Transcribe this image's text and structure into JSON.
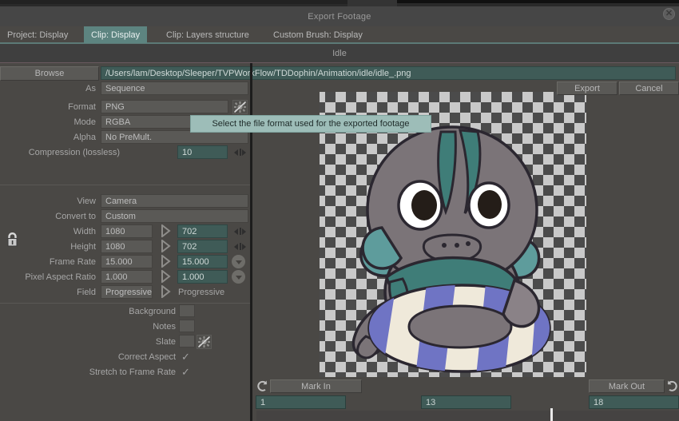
{
  "window": {
    "title": "Export Footage",
    "close_icon": "close-icon"
  },
  "tabs": [
    {
      "label": "Project: Display",
      "active": false
    },
    {
      "label": "Clip: Display",
      "active": true
    },
    {
      "label": "Clip: Layers structure",
      "active": false
    },
    {
      "label": "Custom Brush: Display",
      "active": false
    }
  ],
  "subtitle": "Idle",
  "browse": {
    "button_label": "Browse",
    "path_value": "/Users/lam/Desktop/Sleeper/TVPWorkFlow/TDDophin/Animation/idle/idle_.png"
  },
  "actions": {
    "export_label": "Export",
    "cancel_label": "Cancel"
  },
  "tooltip": {
    "text": "Select the file format used for the exported footage",
    "background": "#9dbdb8",
    "color": "#1e2a28"
  },
  "form": {
    "as": {
      "label": "As",
      "value": "Sequence"
    },
    "format": {
      "label": "Format",
      "value": "PNG",
      "gear_icon": "gear-disabled-icon"
    },
    "mode": {
      "label": "Mode",
      "value": "RGBA"
    },
    "alpha": {
      "label": "Alpha",
      "value": "No PreMult."
    },
    "compression": {
      "label": "Compression (lossless)",
      "value": "10"
    },
    "view": {
      "label": "View",
      "value": "Camera"
    },
    "convert_to": {
      "label": "Convert to",
      "value": "Custom"
    },
    "width": {
      "label": "Width",
      "source": "1080",
      "target": "702"
    },
    "height": {
      "label": "Height",
      "source": "1080",
      "target": "702"
    },
    "frame_rate": {
      "label": "Frame Rate",
      "source": "15.000",
      "target": "15.000"
    },
    "pixel_aspect_ratio": {
      "label": "Pixel Aspect Ratio",
      "source": "1.000",
      "target": "1.000"
    },
    "field": {
      "label": "Field",
      "source": "Progressive",
      "target": "Progressive"
    },
    "lock_icon": "lock-icon"
  },
  "options": [
    {
      "label": "Background",
      "type": "box",
      "checked": false
    },
    {
      "label": "Notes",
      "type": "box",
      "checked": false
    },
    {
      "label": "Slate",
      "type": "box",
      "checked": false,
      "extra_icon": "gear-disabled-icon"
    },
    {
      "label": "Correct Aspect",
      "type": "check",
      "checked": true,
      "glyph": "✓"
    },
    {
      "label": "Stretch to Frame Rate",
      "type": "check",
      "checked": true,
      "glyph": "✓"
    }
  ],
  "timeline": {
    "mark_in_label": "Mark In",
    "mark_out_label": "Mark Out",
    "mark_in_value": "1",
    "current_value": "13",
    "mark_out_value": "18",
    "loop_in_icon": "loop-icon",
    "loop_out_icon": "loop-icon"
  },
  "preview": {
    "alpha_checker": true,
    "artwork_name": "dolphin-character-with-swim-ring",
    "colors": {
      "body": "#7b7478",
      "body_dark": "#6a6368",
      "scarf": "#3f7d78",
      "fin": "#5e9c9c",
      "ring_blue": "#6f74c4",
      "ring_cream": "#efe9da",
      "outline": "#2b2730"
    }
  },
  "theme": {
    "panel": "#4a4845",
    "field": "#5a5956",
    "field_teal": "#3f5b57",
    "accent_tab": "#5d8480",
    "text": "#a6a6a6"
  }
}
